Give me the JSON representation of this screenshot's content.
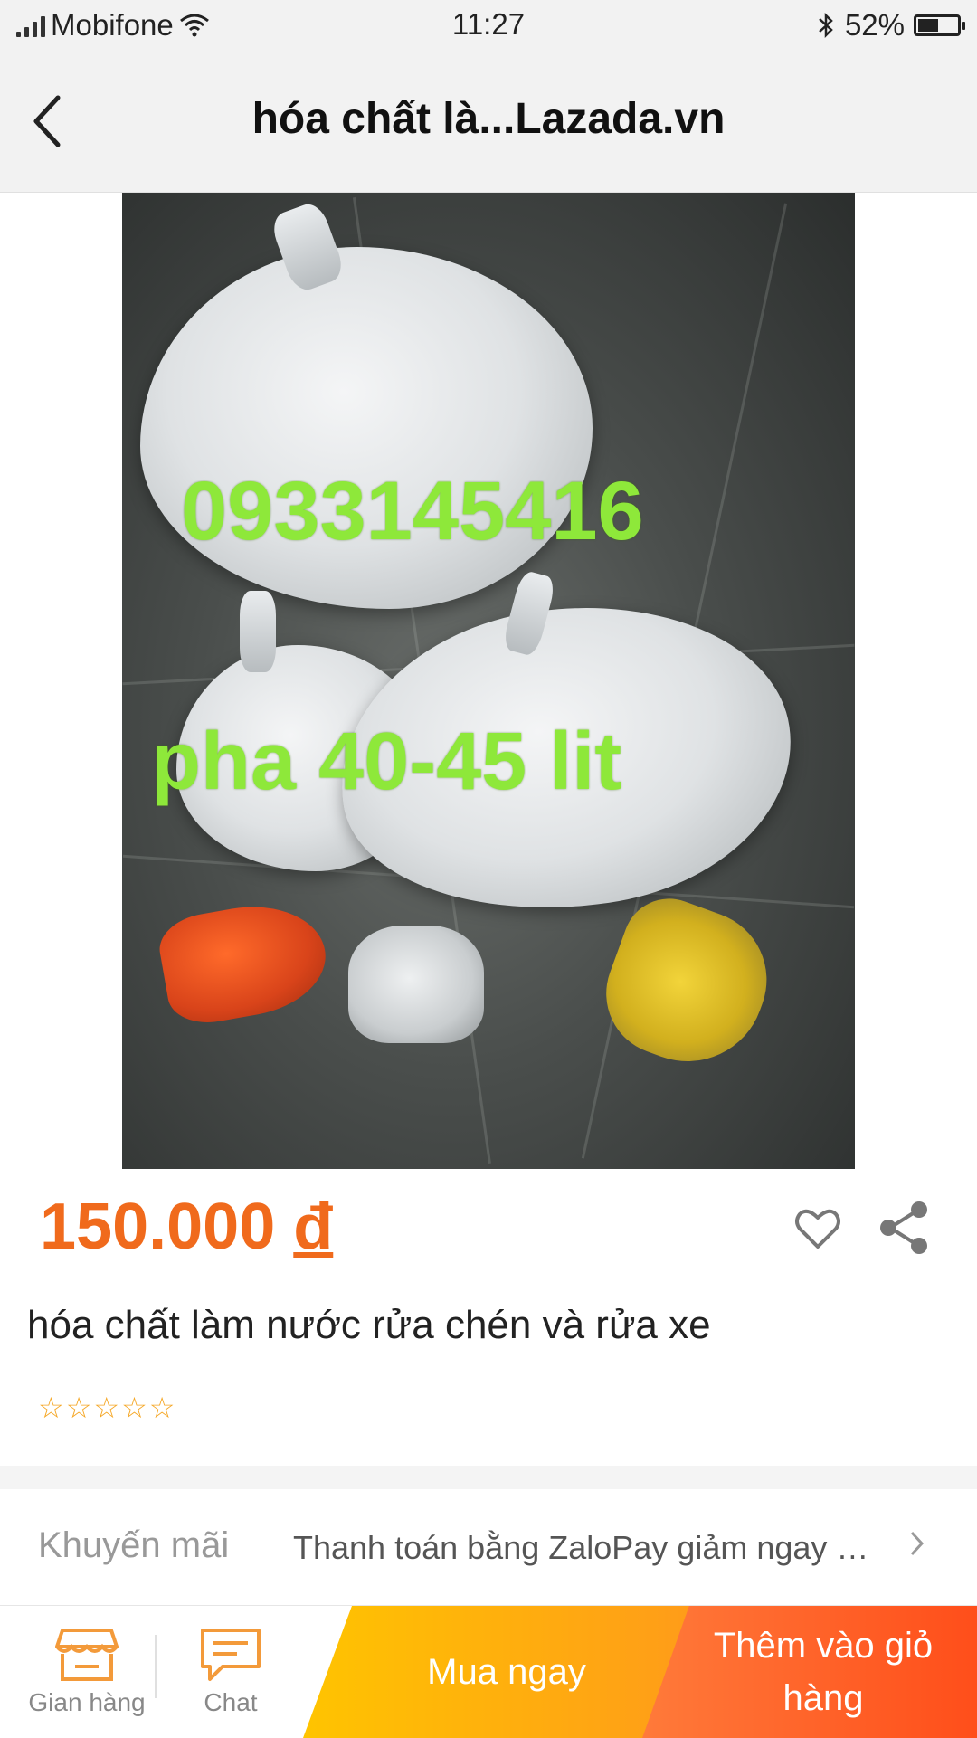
{
  "status_bar": {
    "carrier": "Mobifone",
    "time": "11:27",
    "battery": "52%",
    "battery_level": 0.52
  },
  "header": {
    "title": "hóa chất là...Lazada.vn"
  },
  "image": {
    "phone_text": "0933145416",
    "mix_text": "pha 40-45 lit"
  },
  "product": {
    "price": "150.000",
    "currency": "đ",
    "name": "hóa chất làm nước rửa chén và rửa xe",
    "rating_stars": 0,
    "rating_max": 5
  },
  "promo": {
    "label": "Khuyến mãi",
    "text": "Thanh toán bằng ZaloPay giảm ngay 1..."
  },
  "bottom_bar": {
    "store_label": "Gian hàng",
    "chat_label": "Chat",
    "buy_now_label": "Mua ngay",
    "add_to_cart_label": "Thêm vào giỏ hàng"
  },
  "colors": {
    "price": "#f06a1c",
    "buy_now": "#ffb000",
    "add_to_cart": "#ff5a22",
    "overlay_text": "#8ee83a"
  }
}
